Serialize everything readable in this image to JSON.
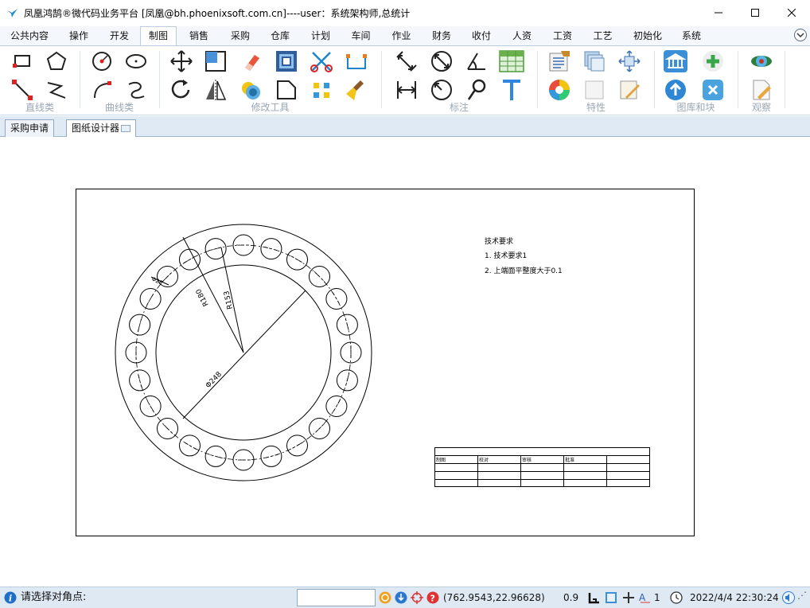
{
  "window": {
    "title": "凤凰鸿鹄®微代码业务平台  [凤凰@bh.phoenixsoft.com.cn]----user：系统架构师,总统计",
    "buttons": [
      "minimize",
      "maximize",
      "close"
    ]
  },
  "menu": {
    "items": [
      "公共内容",
      "操作",
      "开发",
      "制图",
      "销售",
      "采购",
      "仓库",
      "计划",
      "车间",
      "作业",
      "财务",
      "收付",
      "人资",
      "工资",
      "工艺",
      "初始化",
      "系统"
    ],
    "active": "制图"
  },
  "ribbon": {
    "groups": [
      {
        "label": "直线类",
        "icons": [
          "rectangle-icon",
          "pentagon-icon",
          "line-icon",
          "polyline-icon"
        ]
      },
      {
        "label": "曲线类",
        "icons": [
          "circle-icon",
          "ellipse-icon",
          "arc-icon",
          "spline-icon"
        ]
      },
      {
        "label": "修改工具",
        "icons": [
          "move-icon",
          "scale-icon",
          "eraser-icon",
          "offset-icon",
          "trim-icon",
          "break-icon",
          "rotate-icon",
          "mirror-icon",
          "array-icon",
          "chamfer-icon",
          "explode-icon",
          "clear-icon"
        ]
      },
      {
        "label": "标注",
        "icons": [
          "aligned-dim-icon",
          "diameter-dim-icon",
          "angle-dim-icon",
          "table-icon",
          "linear-dim-icon",
          "radius-dim-icon",
          "leader-icon",
          "text-icon"
        ]
      },
      {
        "label": "特性",
        "icons": [
          "properties-icon",
          "layers-icon",
          "match-icon",
          "color-icon",
          "fill-icon",
          "hatch-icon"
        ]
      },
      {
        "label": "图库和块",
        "icons": [
          "library-icon",
          "add-block-icon",
          "upload-icon",
          "remove-block-icon"
        ]
      },
      {
        "label": "观察",
        "icons": [
          "view-icon",
          "edit-view-icon"
        ]
      }
    ]
  },
  "doc_tabs": {
    "items": [
      "采购申请",
      "图纸设计器"
    ],
    "active": "图纸设计器"
  },
  "drawing": {
    "tech_title": "技术要求",
    "tech_item1": "1. 技术要求1",
    "tech_item2": "2. 上端面平整度大于0.1",
    "dim_r180": "R180",
    "dim_r153": "R153",
    "dim_phi": "Φ248",
    "dim_small": "Φ28",
    "title_block": [
      "制图",
      "校对",
      "审核",
      "批准",
      ""
    ]
  },
  "status": {
    "prompt": "请选择对角点:",
    "input_value": "",
    "coords": "(762.9543,22.96628)",
    "scale": "0.9",
    "text_size": "1",
    "datetime": "2022/4/4 22:30:24"
  }
}
